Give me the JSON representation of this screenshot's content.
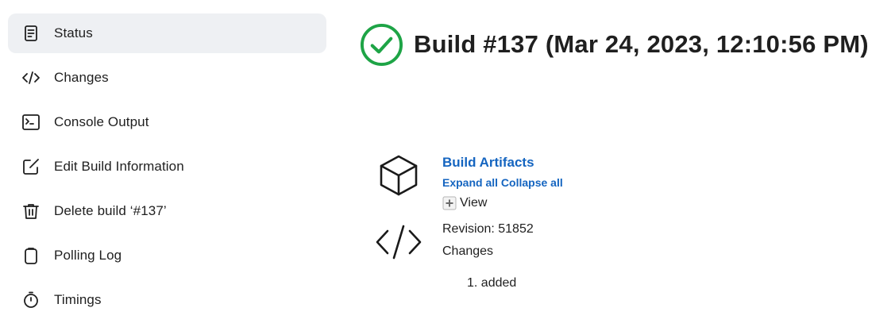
{
  "sidebar": {
    "items": [
      {
        "label": "Status",
        "icon": "document-icon",
        "active": true
      },
      {
        "label": "Changes",
        "icon": "code-icon"
      },
      {
        "label": "Console Output",
        "icon": "terminal-icon"
      },
      {
        "label": "Edit Build Information",
        "icon": "edit-icon"
      },
      {
        "label": "Delete build ‘#137’",
        "icon": "trash-icon"
      },
      {
        "label": "Polling Log",
        "icon": "clipboard-icon"
      },
      {
        "label": "Timings",
        "icon": "stopwatch-icon"
      }
    ]
  },
  "header": {
    "status_icon": "success-check-icon",
    "status_color": "#1ea446",
    "title": "Build #137 (Mar 24, 2023, 12:10:56 PM)"
  },
  "artifacts": {
    "icon": "package-icon",
    "title": "Build Artifacts",
    "expand_all": "Expand all",
    "collapse_all": "Collapse all",
    "view_label": "View"
  },
  "changes": {
    "icon": "code-icon",
    "revision": "Revision: 51852",
    "label": "Changes",
    "items": [
      "1. added"
    ]
  },
  "colors": {
    "link": "#1565c0",
    "active_bg": "#eef0f3",
    "text": "#1f1f1f"
  }
}
